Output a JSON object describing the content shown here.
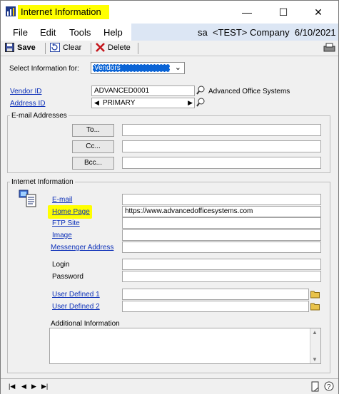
{
  "window": {
    "title": "Internet Information"
  },
  "menu": {
    "items": [
      "File",
      "Edit",
      "Tools",
      "Help"
    ],
    "context": "sa  <TEST> Company  6/10/2021"
  },
  "toolbar": {
    "save": "Save",
    "clear": "Clear",
    "delete": "Delete"
  },
  "select_info": {
    "label": "Select Information for:",
    "value": "Vendors"
  },
  "vendor": {
    "id_label": "Vendor ID",
    "id_value": "ADVANCED0001",
    "name": "Advanced Office Systems",
    "address_label": "Address ID",
    "address_value": "PRIMARY"
  },
  "email_group": {
    "title": "E-mail Addresses",
    "to": "To...",
    "cc": "Cc...",
    "bcc": "Bcc..."
  },
  "internet_group": {
    "title": "Internet Information",
    "email_label": "E-mail",
    "homepage_label": "Home Page",
    "homepage_value": "https://www.advancedofficesystems.com",
    "ftp_label": "FTP Site",
    "image_label": "Image",
    "messenger_label": "Messenger Address",
    "login_label": "Login",
    "password_label": "Password",
    "user1_label": "User Defined 1",
    "user2_label": "User Defined 2",
    "additional_label": "Additional Information"
  },
  "colors": {
    "highlight": "#ffff00",
    "link": "#0b2fb8",
    "select_bg": "#0a64d6"
  }
}
